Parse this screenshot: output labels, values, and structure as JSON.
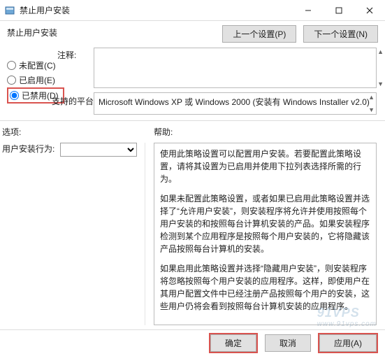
{
  "window": {
    "title": "禁止用户安装",
    "header": "禁止用户安装"
  },
  "nav": {
    "prev": "上一个设置(P)",
    "next": "下一个设置(N)"
  },
  "radios": {
    "not_configured": "未配置(C)",
    "enabled": "已启用(E)",
    "disabled": "已禁用(D)",
    "selected": "disabled"
  },
  "comment": {
    "label": "注释:",
    "value": ""
  },
  "platform": {
    "label": "支持的平台:",
    "value": "Microsoft Windows XP 或 Windows 2000 (安装有 Windows Installer v2.0)"
  },
  "sections": {
    "options": "选项:",
    "help": "帮助:"
  },
  "options": {
    "behavior_label": "用户安装行为:",
    "behavior_value": ""
  },
  "help": {
    "p1": "使用此策略设置可以配置用户安装。若要配置此策略设置，请将其设置为已启用并使用下拉列表选择所需的行为。",
    "p2": "如果未配置此策略设置，或者如果已启用此策略设置并选择了“允许用户安装”，则安装程序将允许并使用按照每个用户安装的和按照每台计算机安装的产品。如果安装程序检测到某个应用程序是按照每个用户安装的，它将隐藏该产品按照每台计算机的安装。",
    "p3": "如果启用此策略设置并选择“隐藏用户安装”，则安装程序将忽略按照每个用户安装的应用程序。这样，即使用户在其用户配置文件中已经注册产品按照每个用户的安装，这些用户仍将会看到按照每台计算机安装的应用程序。"
  },
  "buttons": {
    "ok": "确定",
    "cancel": "取消",
    "apply": "应用(A)"
  },
  "watermark": {
    "main": "91VPS",
    "sub": "www.91vps.com"
  }
}
